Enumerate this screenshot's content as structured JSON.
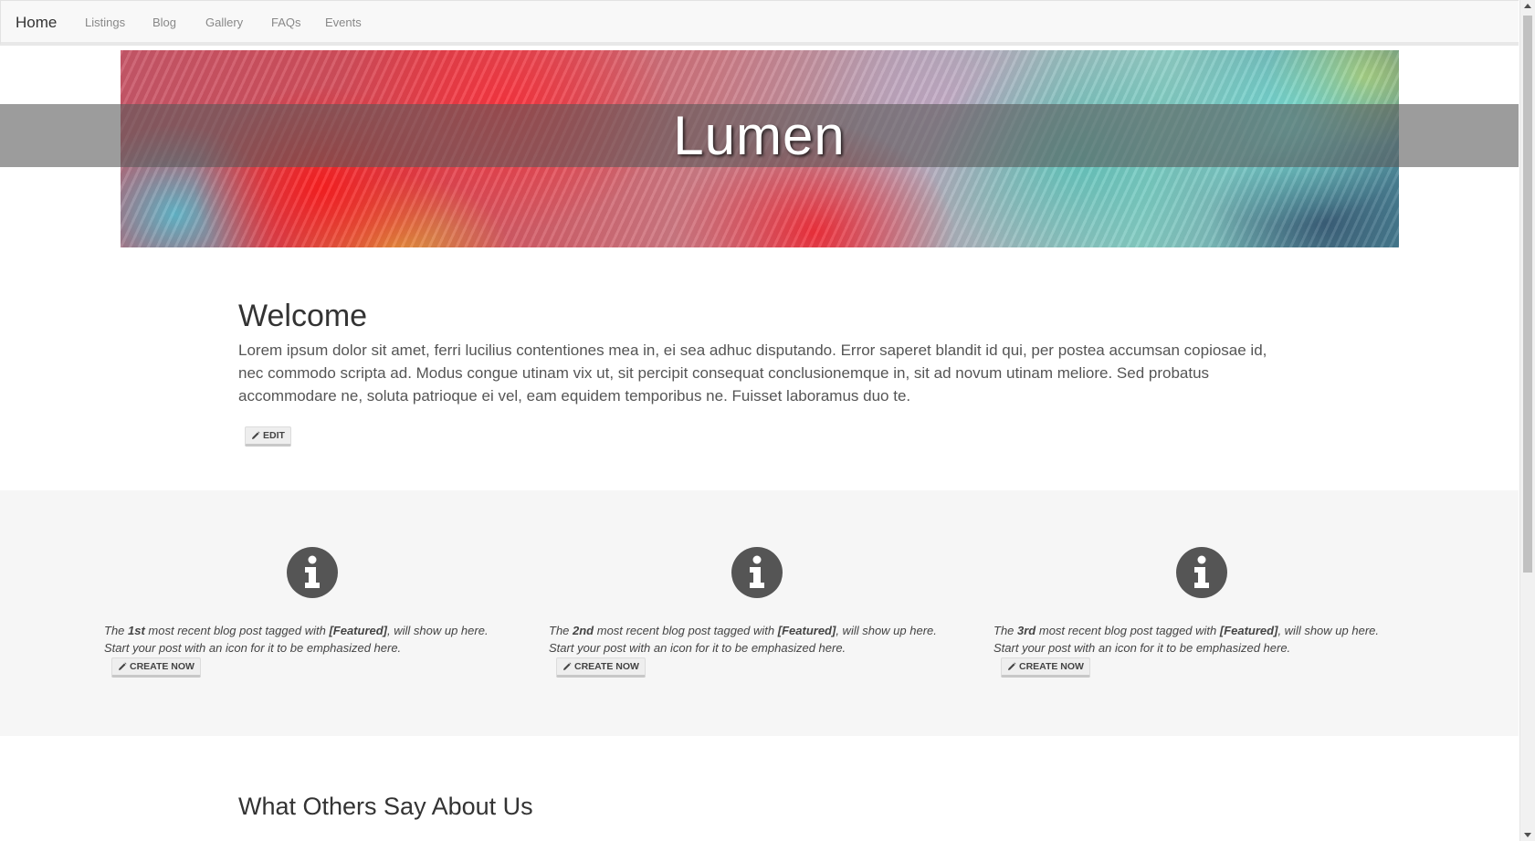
{
  "nav": {
    "brand": "Home",
    "items": [
      {
        "label": "Listings"
      },
      {
        "label": "Blog"
      },
      {
        "label": "Gallery"
      },
      {
        "label": "FAQs"
      },
      {
        "label": "Events"
      }
    ]
  },
  "hero": {
    "title": "Lumen"
  },
  "welcome": {
    "heading": "Welcome",
    "body": "Lorem ipsum dolor sit amet, ferri lucilius contentiones mea in, ei sea adhuc disputando. Error saperet blandit id qui, per postea accumsan copiosae id, nec commodo scripta ad. Modus congue utinam vix ut, sit percipit consequat conclusionemque in, sit ad novum utinam meliore. Sed probatus accommodare ne, soluta patrioque ei vel, eam equidem temporibus ne. Fuisset laboramus duo te.",
    "edit_label": "EDIT"
  },
  "featured": {
    "items": [
      {
        "prefix": "The ",
        "ordinal": "1st",
        "middle": " most recent blog post tagged with ",
        "tag": "[Featured]",
        "suffix": ", will show up here.",
        "line2": "Start your post with an icon for it to be emphasized here.",
        "button_label": "CREATE NOW",
        "icon": "info-icon"
      },
      {
        "prefix": "The ",
        "ordinal": "2nd",
        "middle": " most recent blog post tagged with ",
        "tag": "[Featured]",
        "suffix": ", will show up here.",
        "line2": "Start your post with an icon for it to be emphasized here.",
        "button_label": "CREATE NOW",
        "icon": "info-icon"
      },
      {
        "prefix": "The ",
        "ordinal": "3rd",
        "middle": " most recent blog post tagged with ",
        "tag": "[Featured]",
        "suffix": ", will show up here.",
        "line2": "Start your post with an icon for it to be emphasized here.",
        "button_label": "CREATE NOW",
        "icon": "info-icon"
      }
    ]
  },
  "testimonials": {
    "heading": "What Others Say About Us"
  },
  "colors": {
    "nav_bg": "#f8f8f8",
    "featured_bg": "#f6f6f6",
    "icon": "#555555",
    "text": "#333333"
  }
}
